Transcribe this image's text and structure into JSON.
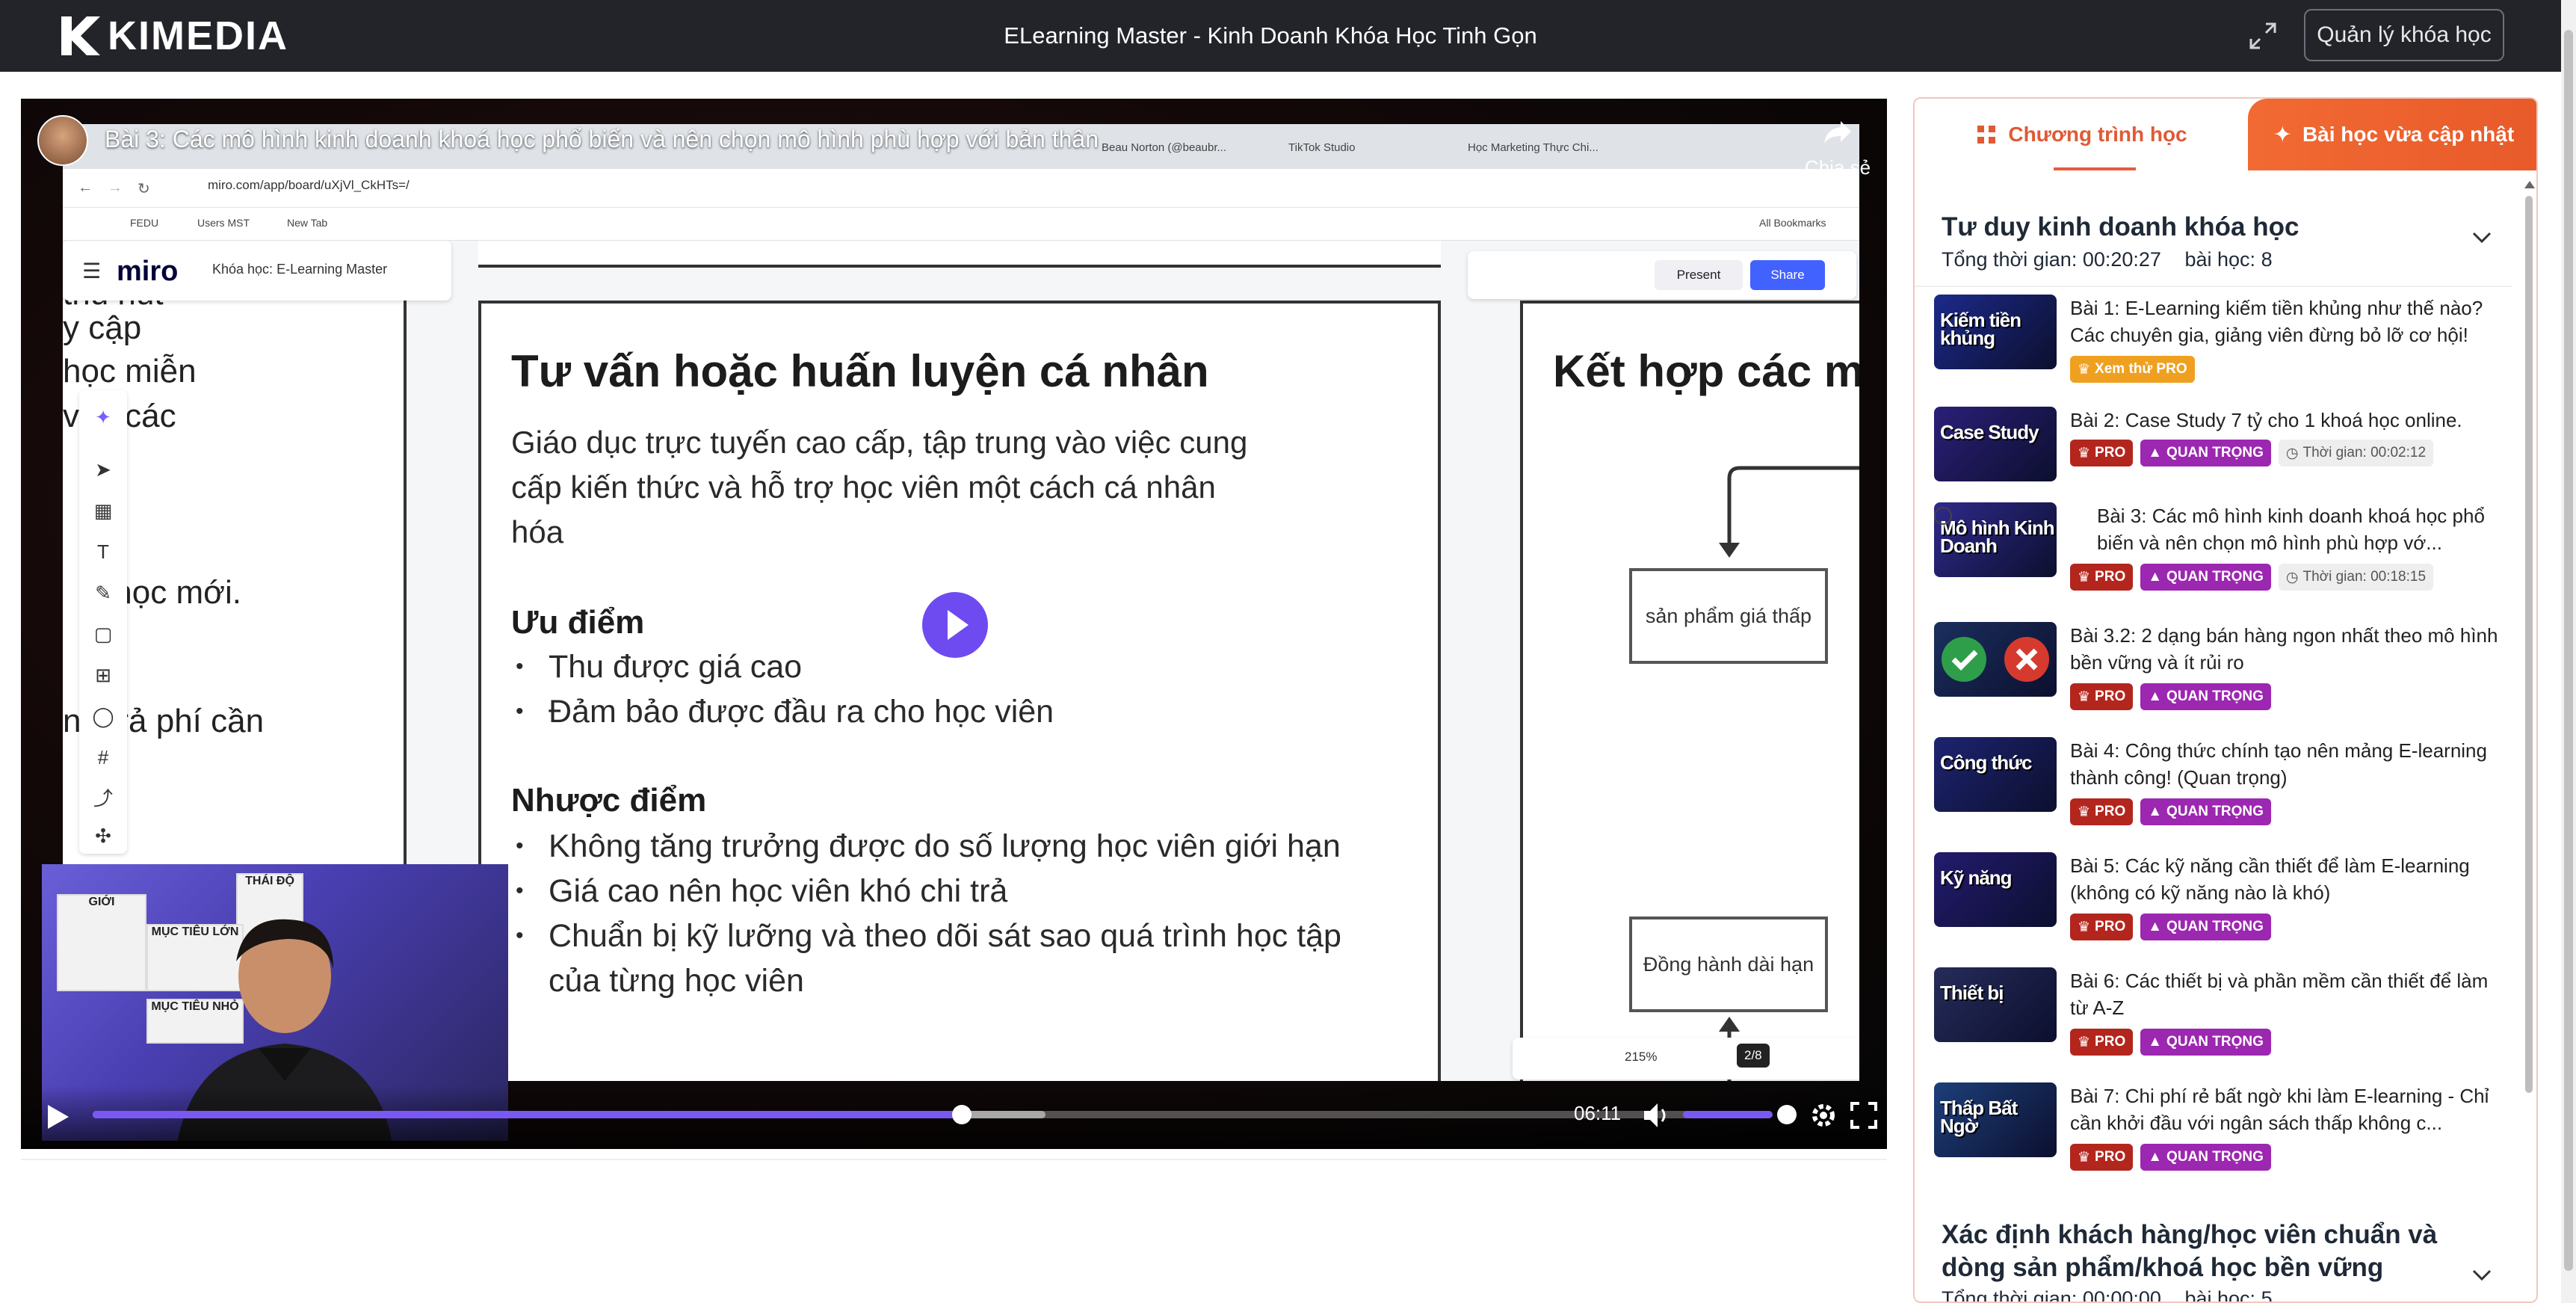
{
  "header": {
    "logo_text": "KIMEDIA",
    "title": "ELearning Master - Kinh Doanh Khóa Học Tinh Gọn",
    "manage_button": "Quản lý khóa học"
  },
  "video": {
    "title": "Bài 3: Các mô hình kinh doanh khoá học phổ biến và nên chọn mô hình phù hợp với bản thân",
    "share_label": "Chia sẻ",
    "current_time": "06:11",
    "progress": 0.52,
    "buffered": 0.57,
    "volume": 0.8,
    "browser": {
      "tabs": [
        "Beau Norton (@beaubr...",
        "TikTok Studio",
        "Học Marketing Thực Chi..."
      ],
      "url": "miro.com/app/board/uXjVl_CkHTs=/",
      "bookmarks": [
        "FEDU",
        "Users MST",
        "New Tab",
        "All Bookmarks"
      ]
    },
    "miro": {
      "logo": "miro",
      "board_name": "Khóa học: E-Learning Master",
      "present": "Present",
      "share": "Share",
      "zoom": "215%",
      "page": "2/8",
      "left_fragments": [
        "thú hút",
        "y cập",
        "học miễn",
        "vào các",
        "T học mới.",
        "ng trả phí cần"
      ],
      "frame_main": {
        "title": "Tư vấn hoặc huấn luyện cá nhân",
        "description": "Giáo dục trực tuyến cao cấp, tập trung vào việc cung cấp kiến thức và hỗ trợ học viên một cách cá nhân hóa",
        "pros_heading": "Ưu điểm",
        "pros": [
          "Thu được giá cao",
          "Đảm bảo được đầu ra cho học viên"
        ],
        "cons_heading": "Nhược điểm",
        "cons": [
          "Không tăng trưởng được do số lượng học viên giới hạn",
          "Giá cao nên học viên khó chi trả",
          "Chuẩn bị kỹ lưỡng và theo dõi sát sao quá trình học tập của từng học viên"
        ]
      },
      "frame_right": {
        "title": "Kết hợp các m",
        "box1": "sản phẩm giá thấp",
        "box2": "Đồng hành dài hạn"
      }
    },
    "webcam_posters": [
      "GIỚI",
      "THÁI ĐỘ",
      "MỤC TIÊU LỚN",
      "MỤC TIÊU NHỎ"
    ]
  },
  "sidebar": {
    "tab_active": "Chương trình học",
    "tab_other": "Bài học vừa cập nhật",
    "section1": {
      "title": "Tư duy kinh doanh khóa học",
      "total_label": "Tổng thời gian:",
      "total_time": "00:20:27",
      "lessons_label": "bài học:",
      "lessons_count": "8"
    },
    "lessons": [
      {
        "title": "Bài 1: E-Learning kiếm tiền khủng như thế nào? Các chuyên gia, giảng viên đừng bỏ lỡ cơ hội!",
        "thumb": "Kiếm tiền khủng",
        "thumb_color": "#1c2a8a",
        "badges": [
          {
            "type": "trial",
            "text": "Xem thử PRO"
          }
        ]
      },
      {
        "title": "Bài 2: Case Study 7 tỷ cho 1 khoá học online.",
        "thumb": "Case Study",
        "thumb_color": "#2b1f78",
        "badges": [
          {
            "type": "pro",
            "text": "PRO"
          },
          {
            "type": "imp",
            "text": "QUAN TRỌNG"
          },
          {
            "type": "time",
            "text": "Thời gian: 00:02:12"
          }
        ]
      },
      {
        "title": "Bài 3: Các mô hình kinh doanh khoá học phổ biến và nên chọn mô hình phù hợp vớ...",
        "thumb": "Mô hình Kinh Doanh",
        "thumb_color": "#2f2a8c",
        "playing": true,
        "badges": [
          {
            "type": "pro",
            "text": "PRO"
          },
          {
            "type": "imp",
            "text": "QUAN TRỌNG"
          },
          {
            "type": "time",
            "text": "Thời gian: 00:18:15"
          }
        ]
      },
      {
        "title": "Bài 3.2: 2 dạng bán hàng ngon nhất theo mô hình bền vững và ít rủi ro",
        "thumb": "",
        "thumb_color": "#1b2f5e",
        "badges": [
          {
            "type": "pro",
            "text": "PRO"
          },
          {
            "type": "imp",
            "text": "QUAN TRỌNG"
          }
        ]
      },
      {
        "title": "Bài 4: Công thức chính tạo nên mảng E-learning thành công! (Quan trọng)",
        "thumb": "Công thức",
        "thumb_color": "#1d2470",
        "badges": [
          {
            "type": "pro",
            "text": "PRO"
          },
          {
            "type": "imp",
            "text": "QUAN TRỌNG"
          }
        ]
      },
      {
        "title": "Bài 5: Các kỹ năng cần thiết để làm E-learning (không có kỹ năng nào là khó)",
        "thumb": "Kỹ năng",
        "thumb_color": "#231b6e",
        "badges": [
          {
            "type": "pro",
            "text": "PRO"
          },
          {
            "type": "imp",
            "text": "QUAN TRỌNG"
          }
        ]
      },
      {
        "title": "Bài 6: Các thiết bị và phần mềm cần thiết để làm từ A-Z",
        "thumb": "Thiết bị",
        "thumb_color": "#262c5a",
        "badges": [
          {
            "type": "pro",
            "text": "PRO"
          },
          {
            "type": "imp",
            "text": "QUAN TRỌNG"
          }
        ]
      },
      {
        "title": "Bài 7: Chi phí rẻ bất ngờ khi làm E-learning - Chỉ cần khởi đầu với ngân sách thấp không c...",
        "thumb": "Thấp Bất Ngờ",
        "thumb_color": "#1d3f7a",
        "badges": [
          {
            "type": "pro",
            "text": "PRO"
          },
          {
            "type": "imp",
            "text": "QUAN TRỌNG"
          }
        ]
      }
    ],
    "section2": {
      "title": "Xác định khách hàng/học viên chuẩn và dòng sản phẩm/khoá học bền vững",
      "total_label": "Tổng thời gian:",
      "total_time": "00:00:00",
      "lessons_label": "bài học:",
      "lessons_count": "5"
    }
  },
  "colors": {
    "topbar": "#22242a",
    "accent": "#e55b3c",
    "player": "#7a58f2",
    "pro": "#b3261e",
    "important": "#9c27b0",
    "trial": "#f0a020"
  }
}
